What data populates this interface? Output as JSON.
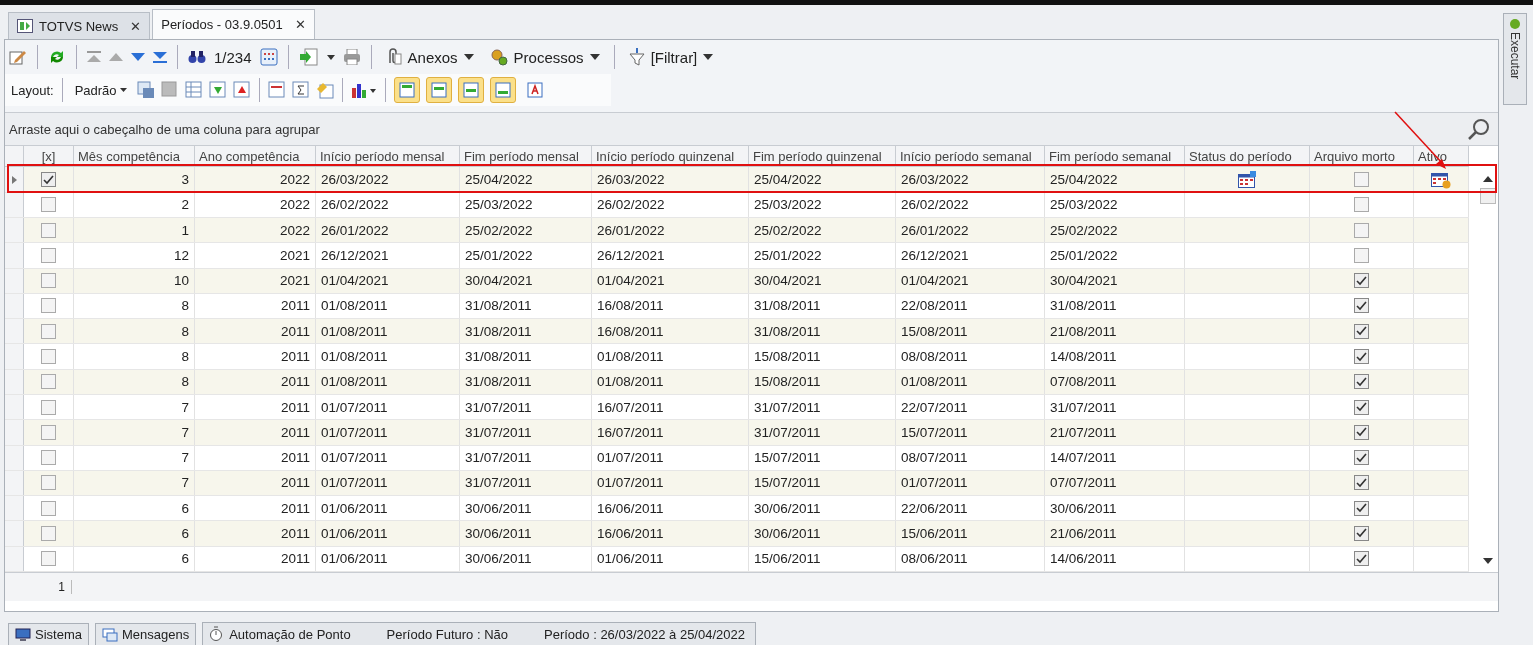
{
  "tabs": [
    {
      "label": "TOTVS News",
      "close": "✕",
      "selected": false
    },
    {
      "label": "Períodos - 03.9.0501",
      "close": "✕",
      "selected": true
    }
  ],
  "toolbar": {
    "record_counter": "1/234",
    "attachments": "Anexos",
    "processes": "Processos",
    "filter": "[Filtrar]"
  },
  "layout_bar": {
    "label": "Layout:",
    "preset": "Padrão",
    "toggles": [
      {
        "on": true
      },
      {
        "on": true
      },
      {
        "on": true
      },
      {
        "on": true
      },
      {
        "on": false
      }
    ]
  },
  "group_panel": {
    "hint": "Arraste aqui o cabeçalho de uma coluna para agrupar"
  },
  "table": {
    "columns": [
      "[x]",
      "Mês competência",
      "Ano competência",
      "Início período mensal",
      "Fim período mensal",
      "Início período quinzenal",
      "Fim período quinzenal",
      "Início período semanal",
      "Fim período semanal",
      "Status do período",
      "Arquivo morto",
      "Ativo"
    ],
    "rows": [
      {
        "selected": true,
        "cells": [
          {
            "checked": true
          },
          "3",
          "2022",
          "26/03/2022",
          "25/04/2022",
          "26/03/2022",
          "25/04/2022",
          "26/03/2022",
          "25/04/2022",
          {
            "flag": true
          },
          {
            "checked": false
          },
          {
            "flag": true
          }
        ]
      },
      {
        "selected": false,
        "cells": [
          {
            "checked": false
          },
          "2",
          "2022",
          "26/02/2022",
          "25/03/2022",
          "26/02/2022",
          "25/03/2022",
          "26/02/2022",
          "25/03/2022",
          {
            "flag": false
          },
          {
            "checked": false
          },
          {
            "flag": false
          }
        ]
      },
      {
        "selected": false,
        "cells": [
          {
            "checked": false
          },
          "1",
          "2022",
          "26/01/2022",
          "25/02/2022",
          "26/01/2022",
          "25/02/2022",
          "26/01/2022",
          "25/02/2022",
          {
            "flag": false
          },
          {
            "checked": false
          },
          {
            "flag": false
          }
        ]
      },
      {
        "selected": false,
        "cells": [
          {
            "checked": false
          },
          "12",
          "2021",
          "26/12/2021",
          "25/01/2022",
          "26/12/2021",
          "25/01/2022",
          "26/12/2021",
          "25/01/2022",
          {
            "flag": false
          },
          {
            "checked": false
          },
          {
            "flag": false
          }
        ]
      },
      {
        "selected": false,
        "cells": [
          {
            "checked": false
          },
          "10",
          "2021",
          "01/04/2021",
          "30/04/2021",
          "01/04/2021",
          "30/04/2021",
          "01/04/2021",
          "30/04/2021",
          {
            "flag": false
          },
          {
            "checked": true
          },
          {
            "flag": false
          }
        ]
      },
      {
        "selected": false,
        "cells": [
          {
            "checked": false
          },
          "8",
          "2011",
          "01/08/2011",
          "31/08/2011",
          "16/08/2011",
          "31/08/2011",
          "22/08/2011",
          "31/08/2011",
          {
            "flag": false
          },
          {
            "checked": true
          },
          {
            "flag": false
          }
        ]
      },
      {
        "selected": false,
        "cells": [
          {
            "checked": false
          },
          "8",
          "2011",
          "01/08/2011",
          "31/08/2011",
          "16/08/2011",
          "31/08/2011",
          "15/08/2011",
          "21/08/2011",
          {
            "flag": false
          },
          {
            "checked": true
          },
          {
            "flag": false
          }
        ]
      },
      {
        "selected": false,
        "cells": [
          {
            "checked": false
          },
          "8",
          "2011",
          "01/08/2011",
          "31/08/2011",
          "01/08/2011",
          "15/08/2011",
          "08/08/2011",
          "14/08/2011",
          {
            "flag": false
          },
          {
            "checked": true
          },
          {
            "flag": false
          }
        ]
      },
      {
        "selected": false,
        "cells": [
          {
            "checked": false
          },
          "8",
          "2011",
          "01/08/2011",
          "31/08/2011",
          "01/08/2011",
          "15/08/2011",
          "01/08/2011",
          "07/08/2011",
          {
            "flag": false
          },
          {
            "checked": true
          },
          {
            "flag": false
          }
        ]
      },
      {
        "selected": false,
        "cells": [
          {
            "checked": false
          },
          "7",
          "2011",
          "01/07/2011",
          "31/07/2011",
          "16/07/2011",
          "31/07/2011",
          "22/07/2011",
          "31/07/2011",
          {
            "flag": false
          },
          {
            "checked": true
          },
          {
            "flag": false
          }
        ]
      },
      {
        "selected": false,
        "cells": [
          {
            "checked": false
          },
          "7",
          "2011",
          "01/07/2011",
          "31/07/2011",
          "16/07/2011",
          "31/07/2011",
          "15/07/2011",
          "21/07/2011",
          {
            "flag": false
          },
          {
            "checked": true
          },
          {
            "flag": false
          }
        ]
      },
      {
        "selected": false,
        "cells": [
          {
            "checked": false
          },
          "7",
          "2011",
          "01/07/2011",
          "31/07/2011",
          "01/07/2011",
          "15/07/2011",
          "08/07/2011",
          "14/07/2011",
          {
            "flag": false
          },
          {
            "checked": true
          },
          {
            "flag": false
          }
        ]
      },
      {
        "selected": false,
        "cells": [
          {
            "checked": false
          },
          "7",
          "2011",
          "01/07/2011",
          "31/07/2011",
          "01/07/2011",
          "15/07/2011",
          "01/07/2011",
          "07/07/2011",
          {
            "flag": false
          },
          {
            "checked": true
          },
          {
            "flag": false
          }
        ]
      },
      {
        "selected": false,
        "cells": [
          {
            "checked": false
          },
          "6",
          "2011",
          "01/06/2011",
          "30/06/2011",
          "16/06/2011",
          "30/06/2011",
          "22/06/2011",
          "30/06/2011",
          {
            "flag": false
          },
          {
            "checked": true
          },
          {
            "flag": false
          }
        ]
      },
      {
        "selected": false,
        "cells": [
          {
            "checked": false
          },
          "6",
          "2011",
          "01/06/2011",
          "30/06/2011",
          "16/06/2011",
          "30/06/2011",
          "15/06/2011",
          "21/06/2011",
          {
            "flag": false
          },
          {
            "checked": true
          },
          {
            "flag": false
          }
        ]
      },
      {
        "selected": false,
        "cells": [
          {
            "checked": false
          },
          "6",
          "2011",
          "01/06/2011",
          "30/06/2011",
          "01/06/2011",
          "15/06/2011",
          "08/06/2011",
          "14/06/2011",
          {
            "flag": false
          },
          {
            "checked": true
          },
          {
            "flag": false
          }
        ]
      }
    ],
    "footer_count": "1"
  },
  "side_panel": {
    "label": "Executar"
  },
  "status_bar": {
    "system": "Sistema",
    "messages": "Mensagens",
    "module": "Automação de Ponto",
    "future_period": "Período Futuro : Não",
    "period": "Período : 26/03/2022 à 25/04/2022"
  }
}
